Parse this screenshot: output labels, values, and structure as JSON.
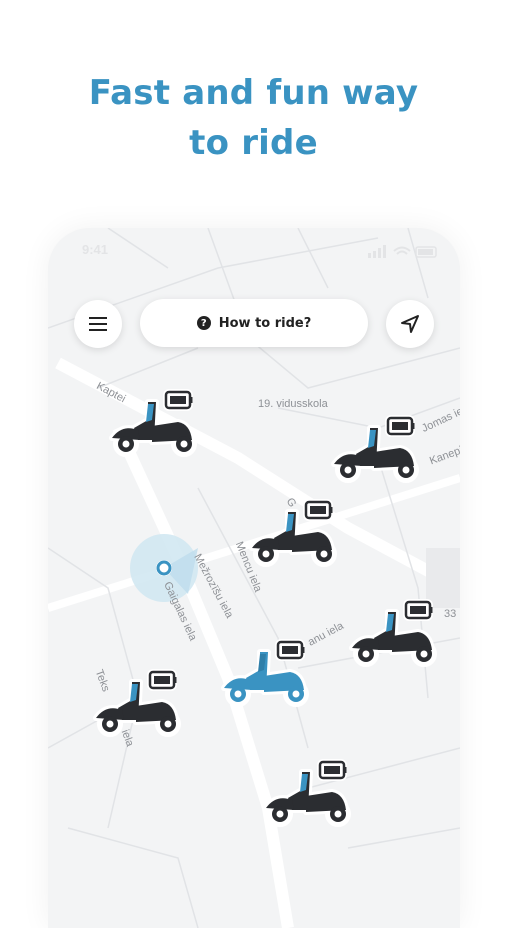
{
  "headline": {
    "line1": "Fast and fun way",
    "line2": "to ride"
  },
  "status_bar": {
    "time": "9:41"
  },
  "map_header": {
    "menu_icon": "hamburger-menu-icon",
    "how_to_label": "How to ride?",
    "help_icon": "question-circle-icon",
    "location_icon": "navigation-arrow-icon"
  },
  "streets": [
    "Kaptei",
    "19. vidusskola",
    "Jomas iela",
    "Kanepi",
    "Mežrozīšu iela",
    "Mencu iela",
    "Gaigalas iela",
    "anu iela",
    "Teks",
    "iela",
    "33",
    "G"
  ],
  "colors": {
    "brand": "#3a93c2",
    "scooter_dark": "#2b2d31",
    "scooter_selected": "#3a93c2",
    "battery_fill": "#2b2d31",
    "map_bg": "#f3f4f5"
  }
}
